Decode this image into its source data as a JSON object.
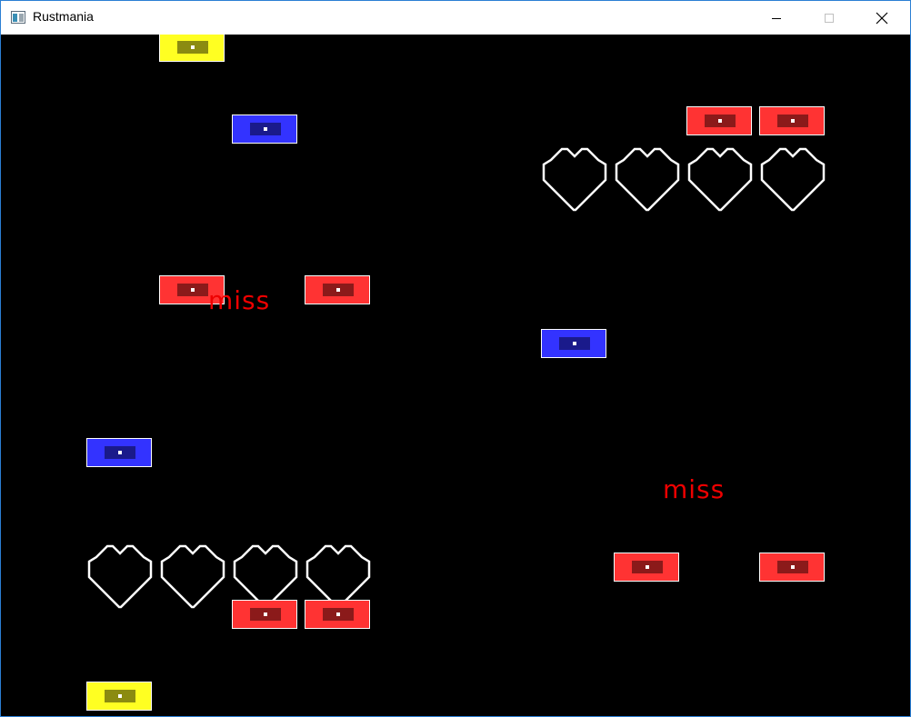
{
  "window": {
    "title": "Rustmania",
    "icons": [
      "app-icon",
      "minimize-icon",
      "maximize-icon",
      "close-icon"
    ]
  },
  "colors": {
    "background": "#000000",
    "red_note": "#ff3333",
    "red_note_inner": "#8b1a1a",
    "blue_note": "#3333ff",
    "blue_note_inner": "#1a1a8b",
    "yellow_note": "#ffff22",
    "yellow_note_inner": "#8b8b11",
    "receptor_outline": "#ffffff",
    "judgment_text": "#ee0000"
  },
  "judgments": {
    "left": "miss",
    "right": "miss"
  }
}
